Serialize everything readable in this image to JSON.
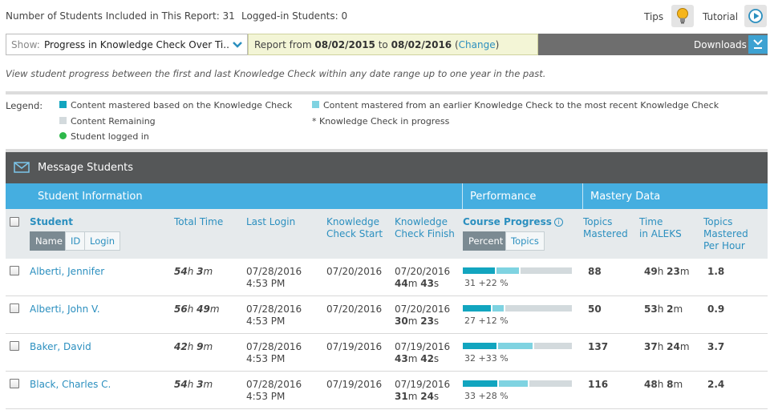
{
  "header": {
    "students_included": "Number of Students Included in This Report: 31",
    "logged_in": "Logged-in Students: 0",
    "tips_label": "Tips",
    "tutorial_label": "Tutorial"
  },
  "report_bar": {
    "show_label": "Show:",
    "show_value": "Progress in Knowledge Check Over Ti...",
    "range_prefix": "Report from ",
    "range_start": "08/02/2015",
    "range_to": " to ",
    "range_end": "08/02/2016",
    "change_open": " (",
    "change_label": "Change",
    "change_close": ")",
    "downloads_label": "Downloads"
  },
  "description": "View student progress between the first and last Knowledge Check within any date range up to one year in the past.",
  "legend": {
    "title": "Legend:",
    "mastered_kc": "Content mastered based on the Knowledge Check",
    "mastered_earlier": "Content mastered from an earlier Knowledge Check to the most recent Knowledge Check",
    "remaining": "Content Remaining",
    "kc_in_progress": "*  Knowledge Check in progress",
    "logged_in": "Student logged in"
  },
  "colors": {
    "mastered_kc": "#12a5bf",
    "mastered_earlier": "#7fd3e1",
    "remaining": "#d3dadd",
    "logged_in": "#2db84a",
    "header_blue": "#45aee0"
  },
  "message_bar": {
    "label": "Message Students",
    "icon": "envelope-icon"
  },
  "groups": {
    "student_info": "Student Information",
    "performance": "Performance",
    "mastery": "Mastery Data"
  },
  "columns": {
    "student": "Student",
    "total_time": "Total Time",
    "last_login": "Last Login",
    "kc_start_1": "Knowledge",
    "kc_start_2": "Check Start",
    "kc_finish_1": "Knowledge",
    "kc_finish_2": "Check Finish",
    "course_progress": "Course Progress",
    "topics_mastered_1": "Topics",
    "topics_mastered_2": "Mastered",
    "time_in_aleks_1": "Time",
    "time_in_aleks_2": "in ALEKS",
    "tmph_1": "Topics",
    "tmph_2": "Mastered",
    "tmph_3": "Per Hour",
    "sort_name": "Name",
    "sort_id": "ID",
    "sort_login": "Login",
    "view_percent": "Percent",
    "view_topics": "Topics"
  },
  "students": [
    {
      "name": "Alberti, Jennifer",
      "total_time": {
        "h": "54",
        "m": "3"
      },
      "last_login_date": "07/28/2016",
      "last_login_time": "4:53 PM",
      "kc_start": "07/20/2016",
      "kc_finish_date": "07/20/2016",
      "kc_finish_dur": {
        "m": "44",
        "s": "43"
      },
      "progress": {
        "base": 31,
        "gain": 22,
        "text": "31 +22 %"
      },
      "topics_mastered": "88",
      "time_in_aleks": {
        "h": "49",
        "m": "23"
      },
      "tmph": "1.8"
    },
    {
      "name": "Alberti, John V.",
      "total_time": {
        "h": "56",
        "m": "49"
      },
      "last_login_date": "07/28/2016",
      "last_login_time": "4:53 PM",
      "kc_start": "07/20/2016",
      "kc_finish_date": "07/20/2016",
      "kc_finish_dur": {
        "m": "30",
        "s": "23"
      },
      "progress": {
        "base": 27,
        "gain": 12,
        "text": "27 +12 %"
      },
      "topics_mastered": "50",
      "time_in_aleks": {
        "h": "53",
        "m": "2"
      },
      "tmph": "0.9"
    },
    {
      "name": "Baker, David",
      "total_time": {
        "h": "42",
        "m": "9"
      },
      "last_login_date": "07/28/2016",
      "last_login_time": "4:53 PM",
      "kc_start": "07/19/2016",
      "kc_finish_date": "07/19/2016",
      "kc_finish_dur": {
        "m": "43",
        "s": "42"
      },
      "progress": {
        "base": 32,
        "gain": 33,
        "text": "32 +33 %"
      },
      "topics_mastered": "137",
      "time_in_aleks": {
        "h": "37",
        "m": "24"
      },
      "tmph": "3.7"
    },
    {
      "name": "Black, Charles C.",
      "total_time": {
        "h": "54",
        "m": "3"
      },
      "last_login_date": "07/28/2016",
      "last_login_time": "4:53 PM",
      "kc_start": "07/19/2016",
      "kc_finish_date": "07/19/2016",
      "kc_finish_dur": {
        "m": "31",
        "s": "24"
      },
      "progress": {
        "base": 33,
        "gain": 28,
        "text": "33 +28 %"
      },
      "topics_mastered": "116",
      "time_in_aleks": {
        "h": "48",
        "m": "8"
      },
      "tmph": "2.4"
    }
  ],
  "units": {
    "h": "h",
    "m": "m",
    "s": "s"
  }
}
